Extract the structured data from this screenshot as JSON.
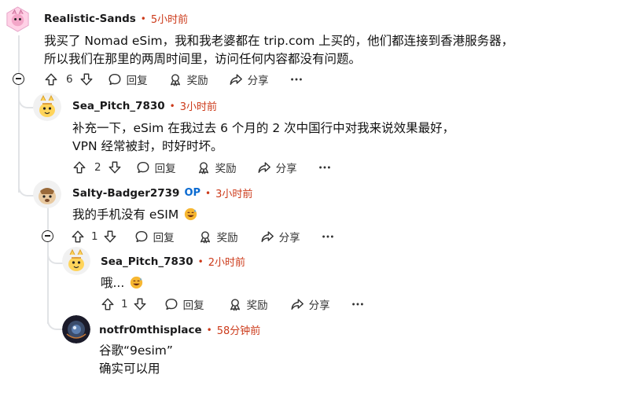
{
  "comments": [
    {
      "username": "Realistic-Sands",
      "time": "5小时前",
      "body_lines": [
        "我买了 Nomad eSim，我和我老婆都在 trip.com 上买的，他们都连接到香港服务器，",
        "所以我们在那里的两周时间里，访问任何内容都没有问题。"
      ],
      "votes": "6",
      "reply_label": "回复",
      "award_label": "奖励",
      "share_label": "分享"
    },
    {
      "username": "Sea_Pitch_7830",
      "time": "3小时前",
      "body_lines": [
        "补充一下，eSim 在我过去 6 个月的 2 次中国行中对我来说效果最好，",
        "VPN 经常被封，时好时坏。"
      ],
      "votes": "2",
      "reply_label": "回复",
      "award_label": "奖励",
      "share_label": "分享"
    },
    {
      "username": "Salty-Badger2739",
      "op_badge": "OP",
      "time": "3小时前",
      "body_lines": [
        "我的手机没有 eSIM"
      ],
      "votes": "1",
      "reply_label": "回复",
      "award_label": "奖励",
      "share_label": "分享"
    },
    {
      "username": "Sea_Pitch_7830",
      "time": "2小时前",
      "body_lines": [
        "哦..."
      ],
      "votes": "1",
      "reply_label": "回复",
      "award_label": "奖励",
      "share_label": "分享"
    },
    {
      "username": "notfr0mthisplace",
      "time": "58分钟前",
      "body_lines": [
        "谷歌“9esim”",
        "确实可以用"
      ]
    }
  ],
  "separator": "•",
  "icons": {
    "upvote": "arrow-up-icon",
    "downvote": "arrow-down-icon",
    "reply": "speech-bubble-icon",
    "award": "award-ribbon-icon",
    "share": "share-arrow-icon",
    "more": "ellipsis-icon",
    "collapse": "collapse-minus-icon",
    "emoji": "sweat-smile-emoji"
  },
  "colors": {
    "timestamp": "#cc3a1a",
    "op_badge": "#0a6ad1",
    "thread_line": "#e1e3e6"
  }
}
